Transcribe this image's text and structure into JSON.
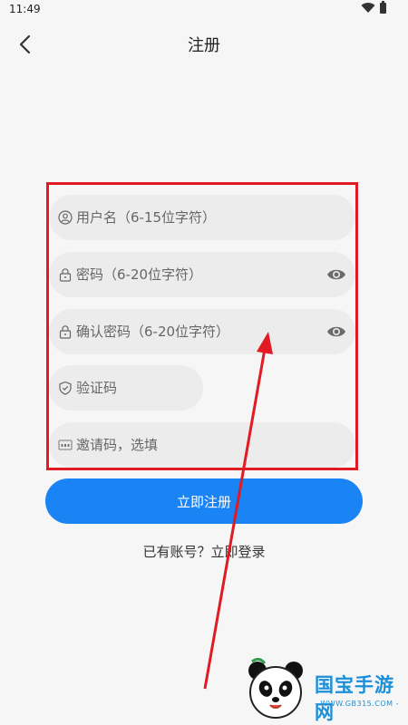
{
  "status_bar": {
    "time": "11:49"
  },
  "app_bar": {
    "title": "注册"
  },
  "form": {
    "username_placeholder": "用户名（6-15位字符）",
    "password_placeholder": "密码（6-20位字符）",
    "confirm_password_placeholder": "确认密码（6-20位字符）",
    "verification_code_placeholder": "验证码",
    "invite_code_placeholder": "邀请码，选填"
  },
  "register_button": {
    "label": "立即注册"
  },
  "login_link": {
    "label": "已有账号？立即登录"
  },
  "watermark": {
    "brand": "国宝手游网",
    "url": "- WWW.GB315.COM -"
  },
  "colors": {
    "accent": "#1a84f5",
    "annotation": "#e01b24"
  },
  "icons": [
    "back-arrow-icon",
    "user-icon",
    "lock-icon",
    "eye-icon",
    "shield-icon",
    "abc-box-icon",
    "wifi-icon",
    "battery-icon"
  ]
}
